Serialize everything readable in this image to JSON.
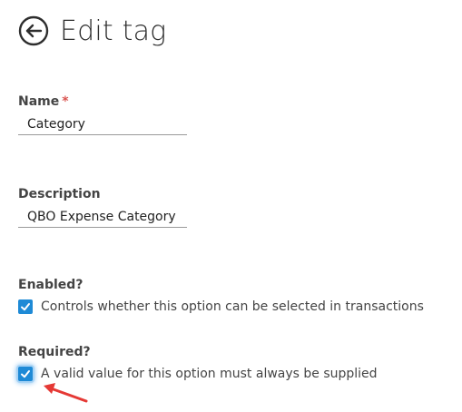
{
  "header": {
    "title": "Edit tag",
    "back_icon": "arrow-left-circle-icon"
  },
  "form": {
    "name": {
      "label": "Name",
      "required_marker": "*",
      "value": "Category"
    },
    "description": {
      "label": "Description",
      "value": "QBO Expense Category"
    },
    "enabled": {
      "label": "Enabled?",
      "checked": true,
      "text": "Controls whether this option can be selected in transactions"
    },
    "required": {
      "label": "Required?",
      "checked": true,
      "text": "A valid value for this option must always be supplied"
    }
  },
  "colors": {
    "accent": "#1e8ad6",
    "required_star": "#d9534f",
    "annotation_arrow": "#e53935"
  }
}
